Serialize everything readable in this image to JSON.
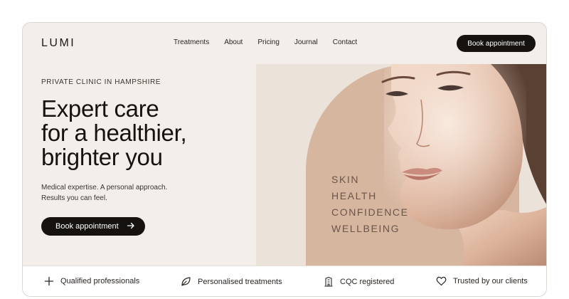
{
  "brand": {
    "logo": "LUMI"
  },
  "nav": {
    "items": [
      {
        "label": "Treatments"
      },
      {
        "label": "About"
      },
      {
        "label": "Pricing"
      },
      {
        "label": "Journal"
      },
      {
        "label": "Contact"
      }
    ],
    "cta_label": "Book appointment"
  },
  "hero": {
    "eyebrow": "PRIVATE CLINIC IN HAMPSHIRE",
    "headline_lines": [
      "Expert care",
      "for a healthier,",
      "brighter you"
    ],
    "sub_lines": [
      "Medical expertise. A personal approach.",
      "Results you can feel."
    ],
    "cta_label": "Book appointment",
    "cta_icon": "arrow-right-icon",
    "image_tags": [
      "SKIN",
      "HEALTH",
      "CONFIDENCE",
      "WELLBEING"
    ]
  },
  "features": [
    {
      "icon": "plus-icon",
      "label": "Qualified professionals"
    },
    {
      "icon": "leaf-icon",
      "label": "Personalised treatments"
    },
    {
      "icon": "building-icon",
      "label": "CQC registered"
    },
    {
      "icon": "heart-icon",
      "label": "Trusted by our clients"
    }
  ],
  "colors": {
    "background": "#f3eee9",
    "button": "#15120f",
    "accent_circle": "#d7b6a0",
    "tag_text": "#6b5549"
  }
}
